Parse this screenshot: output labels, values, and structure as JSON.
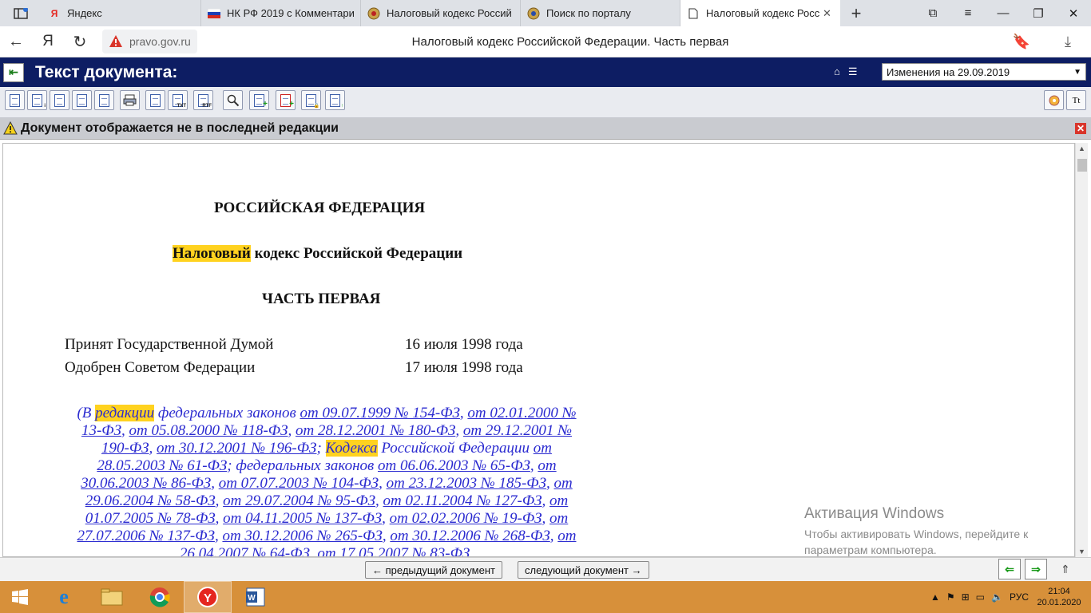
{
  "browser": {
    "tabs": [
      {
        "label": "Яндекс",
        "favicon": "yandex-icon"
      },
      {
        "label": "НК РФ 2019 с Комментари",
        "favicon": "russia-flag-icon"
      },
      {
        "label": "Налоговый кодекс Россий",
        "favicon": "emblem-icon"
      },
      {
        "label": "Поиск по порталу",
        "favicon": "emblem-icon"
      },
      {
        "label": "Налоговый кодекс Росс",
        "favicon": "document-icon"
      }
    ],
    "url": "pravo.gov.ru",
    "page_title": "Налоговый кодекс Российской Федерации. Часть первая"
  },
  "app": {
    "header_title": "Текст документа:",
    "edition_select": "Изменения на 29.09.2019",
    "warning": "Документ отображается не в последней редакции"
  },
  "document": {
    "country": "РОССИЙСКАЯ ФЕДЕРАЦИЯ",
    "title_highlight": "Налоговый",
    "title_rest": " кодекс Российской Федерации",
    "part": "ЧАСТЬ ПЕРВАЯ",
    "adopted_label": "Принят Государственной Думой",
    "adopted_date": "16 июля 1998 года",
    "approved_label": "Одобрен Советом Федерации",
    "approved_date": "17 июля 1998 года",
    "edition_intro_a": "(В ",
    "edition_intro_hl": "редакции",
    "edition_intro_b": " федеральных законов ",
    "edition_mid_hl": "Кодекса",
    "edition_mid_b": " Российской Федерации ",
    "edition_mid_c": "; федеральных законов",
    "links_1": [
      "от 09.07.1999 № 154-ФЗ",
      "от 02.01.2000 № 13-ФЗ",
      "от 05.08.2000 № 118-ФЗ",
      "от 28.12.2001 № 180-ФЗ",
      "от 29.12.2001 № 190-ФЗ",
      "от 30.12.2001 № 196-ФЗ"
    ],
    "link_code": "от 28.05.2003 № 61-ФЗ",
    "links_2": [
      "от 06.06.2003 № 65-ФЗ",
      "от 30.06.2003 № 86-ФЗ",
      "от 07.07.2003 № 104-ФЗ",
      "от 23.12.2003 № 185-ФЗ",
      "от 29.06.2004 № 58-ФЗ",
      "от 29.07.2004 № 95-ФЗ",
      "от 02.11.2004 № 127-ФЗ",
      "от 01.07.2005 № 78-ФЗ",
      "от 04.11.2005 № 137-ФЗ",
      "от 02.02.2006 № 19-ФЗ",
      "от 27.07.2006 № 137-ФЗ",
      "от 30.12.2006 № 265-ФЗ",
      "от 30.12.2006 № 268-ФЗ",
      "от 26.04.2007 № 64-ФЗ",
      "от 17.05.2007 № 83-ФЗ"
    ]
  },
  "watermark": {
    "line1": "Активация Windows",
    "line2": "Чтобы активировать Windows, перейдите к",
    "line3": "параметрам компьютера."
  },
  "bottom_nav": {
    "prev": "← предыдущий документ",
    "next": "следующий документ →"
  },
  "taskbar": {
    "lang": "РУС",
    "time": "21:04",
    "date": "20.01.2020"
  }
}
